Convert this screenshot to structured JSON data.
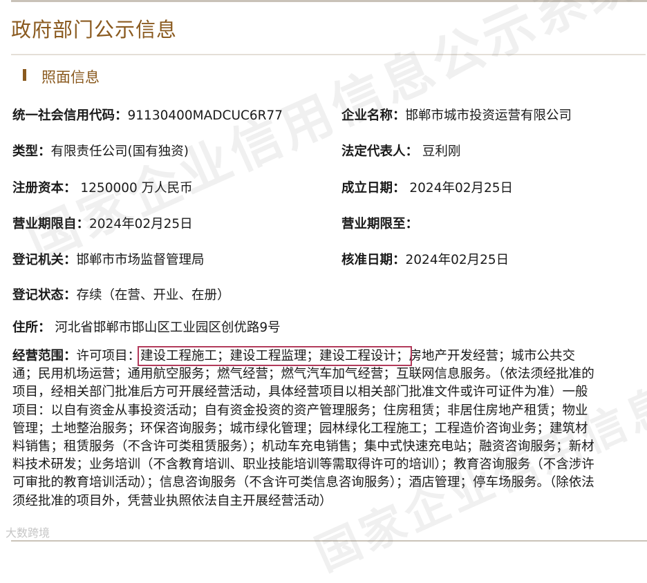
{
  "header": {
    "title": "政府部门公示信息"
  },
  "section": {
    "title": "照面信息"
  },
  "fields": {
    "credit_code": {
      "label": "统一社会信用代码：",
      "value": "91130400MADCUC6R77"
    },
    "company_name": {
      "label": "企业名称：",
      "value": "邯郸市城市投资运营有限公司"
    },
    "type": {
      "label": "类型：",
      "value": "有限责任公司(国有独资)"
    },
    "legal_rep": {
      "label": "法定代表人：",
      "value": " 豆利刚"
    },
    "capital": {
      "label": "注册资本：",
      "value": " 1250000 万人民币"
    },
    "established": {
      "label": "成立日期：",
      "value": " 2024年02月25日"
    },
    "term_from": {
      "label": "营业期限自：",
      "value": "2024年02月25日"
    },
    "term_to": {
      "label": "营业期限至：",
      "value": ""
    },
    "authority": {
      "label": "登记机关：",
      "value": "邯郸市市场监督管理局"
    },
    "approval_date": {
      "label": "核准日期：",
      "value": "2024年02月25日"
    },
    "status": {
      "label": "登记状态：",
      "value": "存续（在营、开业、在册）"
    },
    "address": {
      "label": "住所：",
      "value": " 河北省邯郸市邯山区工业园区创优路9号"
    },
    "scope": {
      "label": "经营范围：",
      "prefix": "许可项目：",
      "highlight": "建设工程施工；建设工程监理；建设工程设计；",
      "rest": "房地产开发经营；城市公共交通；民用机场运营；通用航空服务；燃气经营；燃气汽车加气经营；互联网信息服务。（依法须经批准的项目，经相关部门批准后方可开展经营活动，具体经营项目以相关部门批准文件或许可证件为准）一般项目：以自有资金从事投资活动；自有资金投资的资产管理服务；住房租赁；非居住房地产租赁；物业管理；土地整治服务；环保咨询服务；城市绿化管理；园林绿化工程施工；工程造价咨询业务；建筑材料销售；租赁服务（不含许可类租赁服务）；机动车充电销售；集中式快速充电站；融资咨询服务；新材料技术研发；业务培训（不含教育培训、职业技能培训等需取得许可的培训）；教育咨询服务（不含涉许可审批的教育培训活动）；信息咨询服务（不含许可类信息咨询服务）；酒店管理；停车场服务。（除依法须经批准的项目外，凭营业执照依法自主开展经营活动）"
    }
  },
  "watermark": {
    "text": "国家企业信用信息公示系统",
    "logo": "大数跨境"
  }
}
